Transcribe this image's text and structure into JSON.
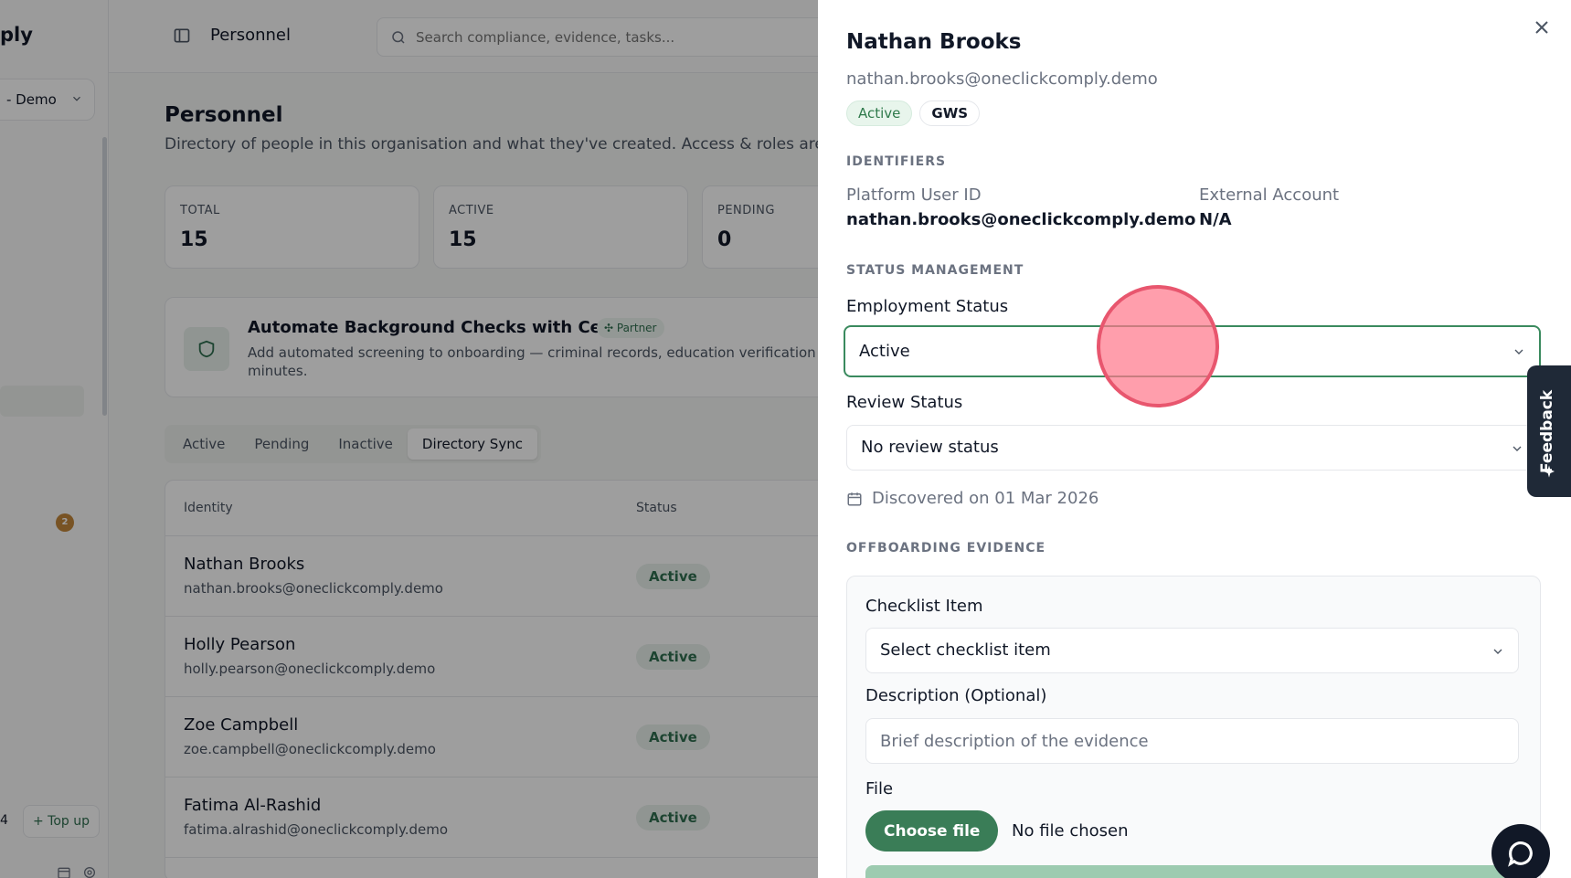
{
  "sidebar": {
    "brand": "ply",
    "org_select": "- Demo",
    "notification_count": "2",
    "credits_count": "4",
    "topup_label": "+ Top up"
  },
  "topbar": {
    "title": "Personnel",
    "search_placeholder": "Search compliance, evidence, tasks..."
  },
  "page": {
    "title": "Personnel",
    "subtitle": "Directory of people in this organisation and what they've created. Access & roles are"
  },
  "stats": [
    {
      "label": "TOTAL",
      "value": "15"
    },
    {
      "label": "ACTIVE",
      "value": "15"
    },
    {
      "label": "PENDING",
      "value": "0"
    }
  ],
  "promo": {
    "title": "Automate Background Checks with Certn",
    "badge": "Partner",
    "description": "Add automated screening to onboarding — criminal records, education verification minutes."
  },
  "tabs": [
    {
      "label": "Active"
    },
    {
      "label": "Pending"
    },
    {
      "label": "Inactive"
    },
    {
      "label": "Directory Sync"
    }
  ],
  "table": {
    "columns": [
      "Identity",
      "Status"
    ],
    "rows": [
      {
        "name": "Nathan Brooks",
        "email": "nathan.brooks@oneclickcomply.demo",
        "status": "Active"
      },
      {
        "name": "Holly Pearson",
        "email": "holly.pearson@oneclickcomply.demo",
        "status": "Active"
      },
      {
        "name": "Zoe Campbell",
        "email": "zoe.campbell@oneclickcomply.demo",
        "status": "Active"
      },
      {
        "name": "Fatima Al-Rashid",
        "email": "fatima.alrashid@oneclickcomply.demo",
        "status": "Active"
      }
    ]
  },
  "drawer": {
    "name": "Nathan Brooks",
    "email": "nathan.brooks@oneclickcomply.demo",
    "badges": [
      "Active",
      "GWS"
    ],
    "identifiers_heading": "IDENTIFIERS",
    "platform_user_id_label": "Platform User ID",
    "platform_user_id": "nathan.brooks@oneclickcomply.demo",
    "external_account_label": "External Account",
    "external_account": "N/A",
    "status_heading": "STATUS MANAGEMENT",
    "employment_status_label": "Employment Status",
    "employment_status": "Active",
    "review_status_label": "Review Status",
    "review_status": "No review status",
    "discovered": "Discovered on 01 Mar 2026",
    "offboarding_heading": "OFFBOARDING EVIDENCE",
    "checklist_label": "Checklist Item",
    "checklist_placeholder": "Select checklist item",
    "description_label": "Description (Optional)",
    "description_placeholder": "Brief description of the evidence",
    "file_label": "File",
    "choose_file": "Choose file",
    "no_file": "No file chosen"
  },
  "feedback_label": "Feedback",
  "colors": {
    "accent": "#3a7d57",
    "focus_border": "#3a8a5e",
    "badge_green_bg": "#e8f5ec",
    "cursor": "#e8566e"
  }
}
